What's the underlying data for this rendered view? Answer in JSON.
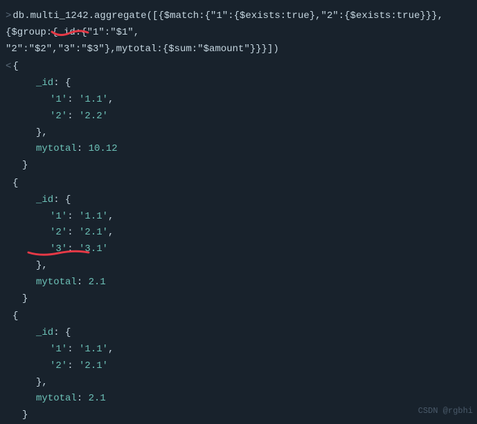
{
  "command_line1": "db.multi_1242.aggregate([{$match:{\"1\":{$exists:true},\"2\":{$exists:true}}},{$group:{_id:{\"1\":\"$1\",",
  "command_line2": "\"2\":\"$2\",\"3\":\"$3\"},mytotal:{$sum:\"$amount\"}}}])",
  "results": [
    {
      "idEntries": [
        {
          "k": "'1'",
          "v": "'1.1'"
        },
        {
          "k": "'2'",
          "v": "'2.2'"
        }
      ],
      "mytotal": "10.12"
    },
    {
      "idEntries": [
        {
          "k": "'1'",
          "v": "'1.1'"
        },
        {
          "k": "'2'",
          "v": "'2.1'"
        },
        {
          "k": "'3'",
          "v": "'3.1'"
        }
      ],
      "mytotal": "2.1"
    },
    {
      "idEntries": [
        {
          "k": "'1'",
          "v": "'1.1'"
        },
        {
          "k": "'2'",
          "v": "'2.1'"
        }
      ],
      "mytotal": "2.1"
    }
  ],
  "labels": {
    "idKey": "_id",
    "mytotalKey": "mytotal",
    "watermark": "CSDN @rgbhi"
  }
}
